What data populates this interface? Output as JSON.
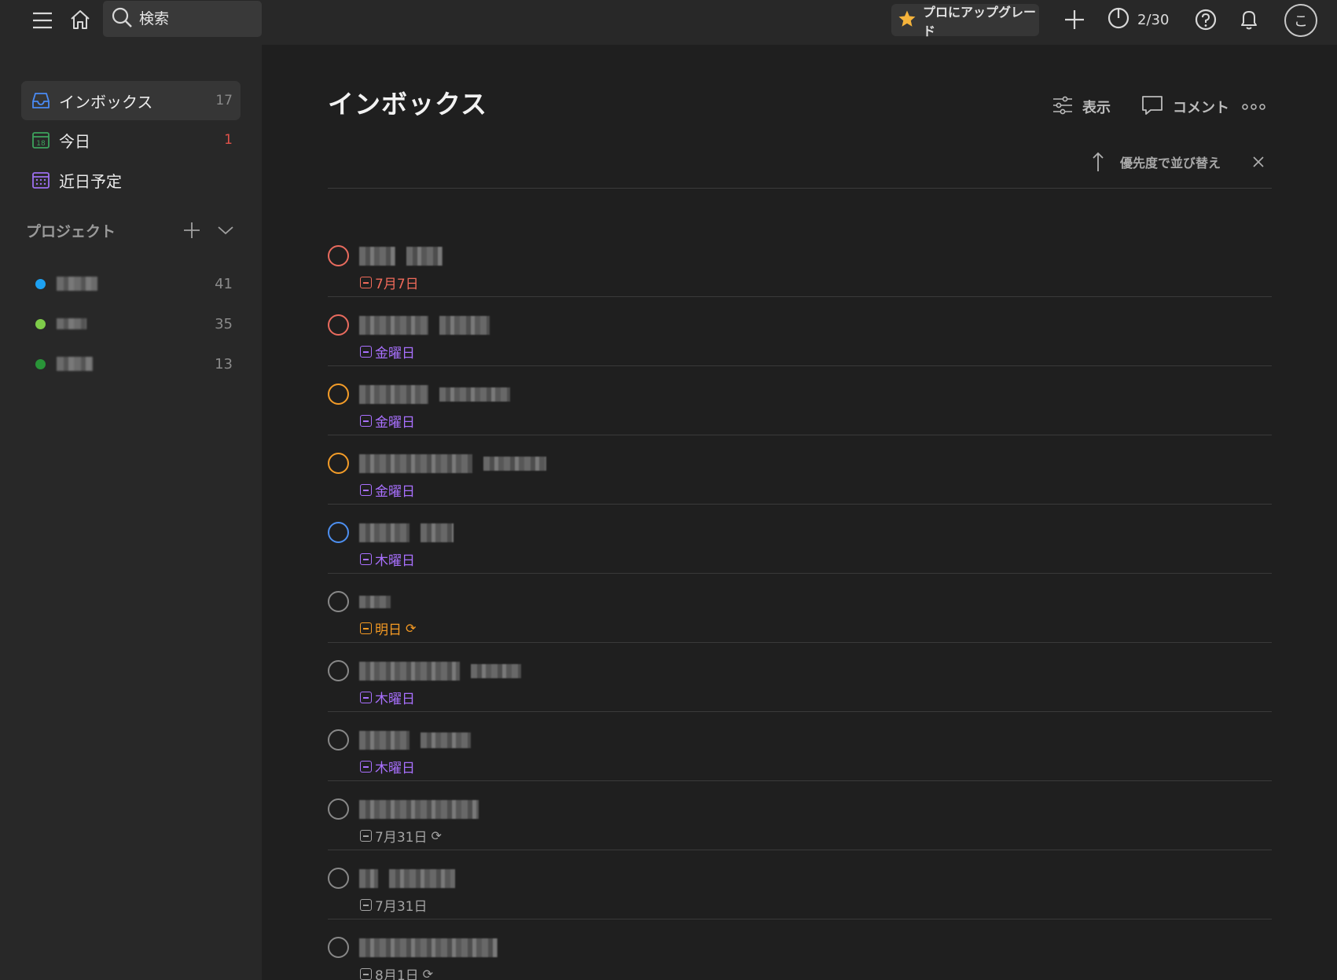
{
  "header": {
    "search_placeholder": "検索",
    "upgrade_label": "プロにアップグレード",
    "karma_label": "2/30",
    "avatar_initial": "こ"
  },
  "sidebar": {
    "nav": [
      {
        "label": "インボックス",
        "count": "17",
        "icon": "inbox-icon"
      },
      {
        "label": "今日",
        "count": "1",
        "icon": "calendar-today-icon"
      },
      {
        "label": "近日予定",
        "count": "",
        "icon": "calendar-upcoming-icon"
      }
    ],
    "projects_label": "プロジェクト",
    "projects": [
      {
        "count": "41",
        "color": "#1da1f2"
      },
      {
        "count": "35",
        "color": "#7ecc49"
      },
      {
        "count": "13",
        "color": "#299438"
      }
    ]
  },
  "main": {
    "title": "インボックス",
    "view_label": "表示",
    "comment_label": "コメント",
    "sort_label": "優先度で並び替え",
    "tasks": [
      {
        "priority": "p1",
        "due": "7月7日",
        "due_color": "red",
        "repeat": false
      },
      {
        "priority": "p1",
        "due": "金曜日",
        "due_color": "purple",
        "repeat": false
      },
      {
        "priority": "p2",
        "due": "金曜日",
        "due_color": "purple",
        "repeat": false
      },
      {
        "priority": "p2",
        "due": "金曜日",
        "due_color": "purple",
        "repeat": false
      },
      {
        "priority": "p3",
        "due": "木曜日",
        "due_color": "purple",
        "repeat": false
      },
      {
        "priority": "p4",
        "due": "明日",
        "due_color": "orange",
        "repeat": true
      },
      {
        "priority": "p4",
        "due": "木曜日",
        "due_color": "purple",
        "repeat": false
      },
      {
        "priority": "p4",
        "due": "木曜日",
        "due_color": "purple",
        "repeat": false
      },
      {
        "priority": "p4",
        "due": "7月31日",
        "due_color": "gray",
        "repeat": true
      },
      {
        "priority": "p4",
        "due": "7月31日",
        "due_color": "gray",
        "repeat": false
      },
      {
        "priority": "p4",
        "due": "8月1日",
        "due_color": "gray",
        "repeat": true
      }
    ]
  },
  "colors": {
    "priority_1": "#e96b5e",
    "priority_2": "#f39c28",
    "priority_3": "#4d8ff0",
    "due_purple": "#a970ff"
  }
}
